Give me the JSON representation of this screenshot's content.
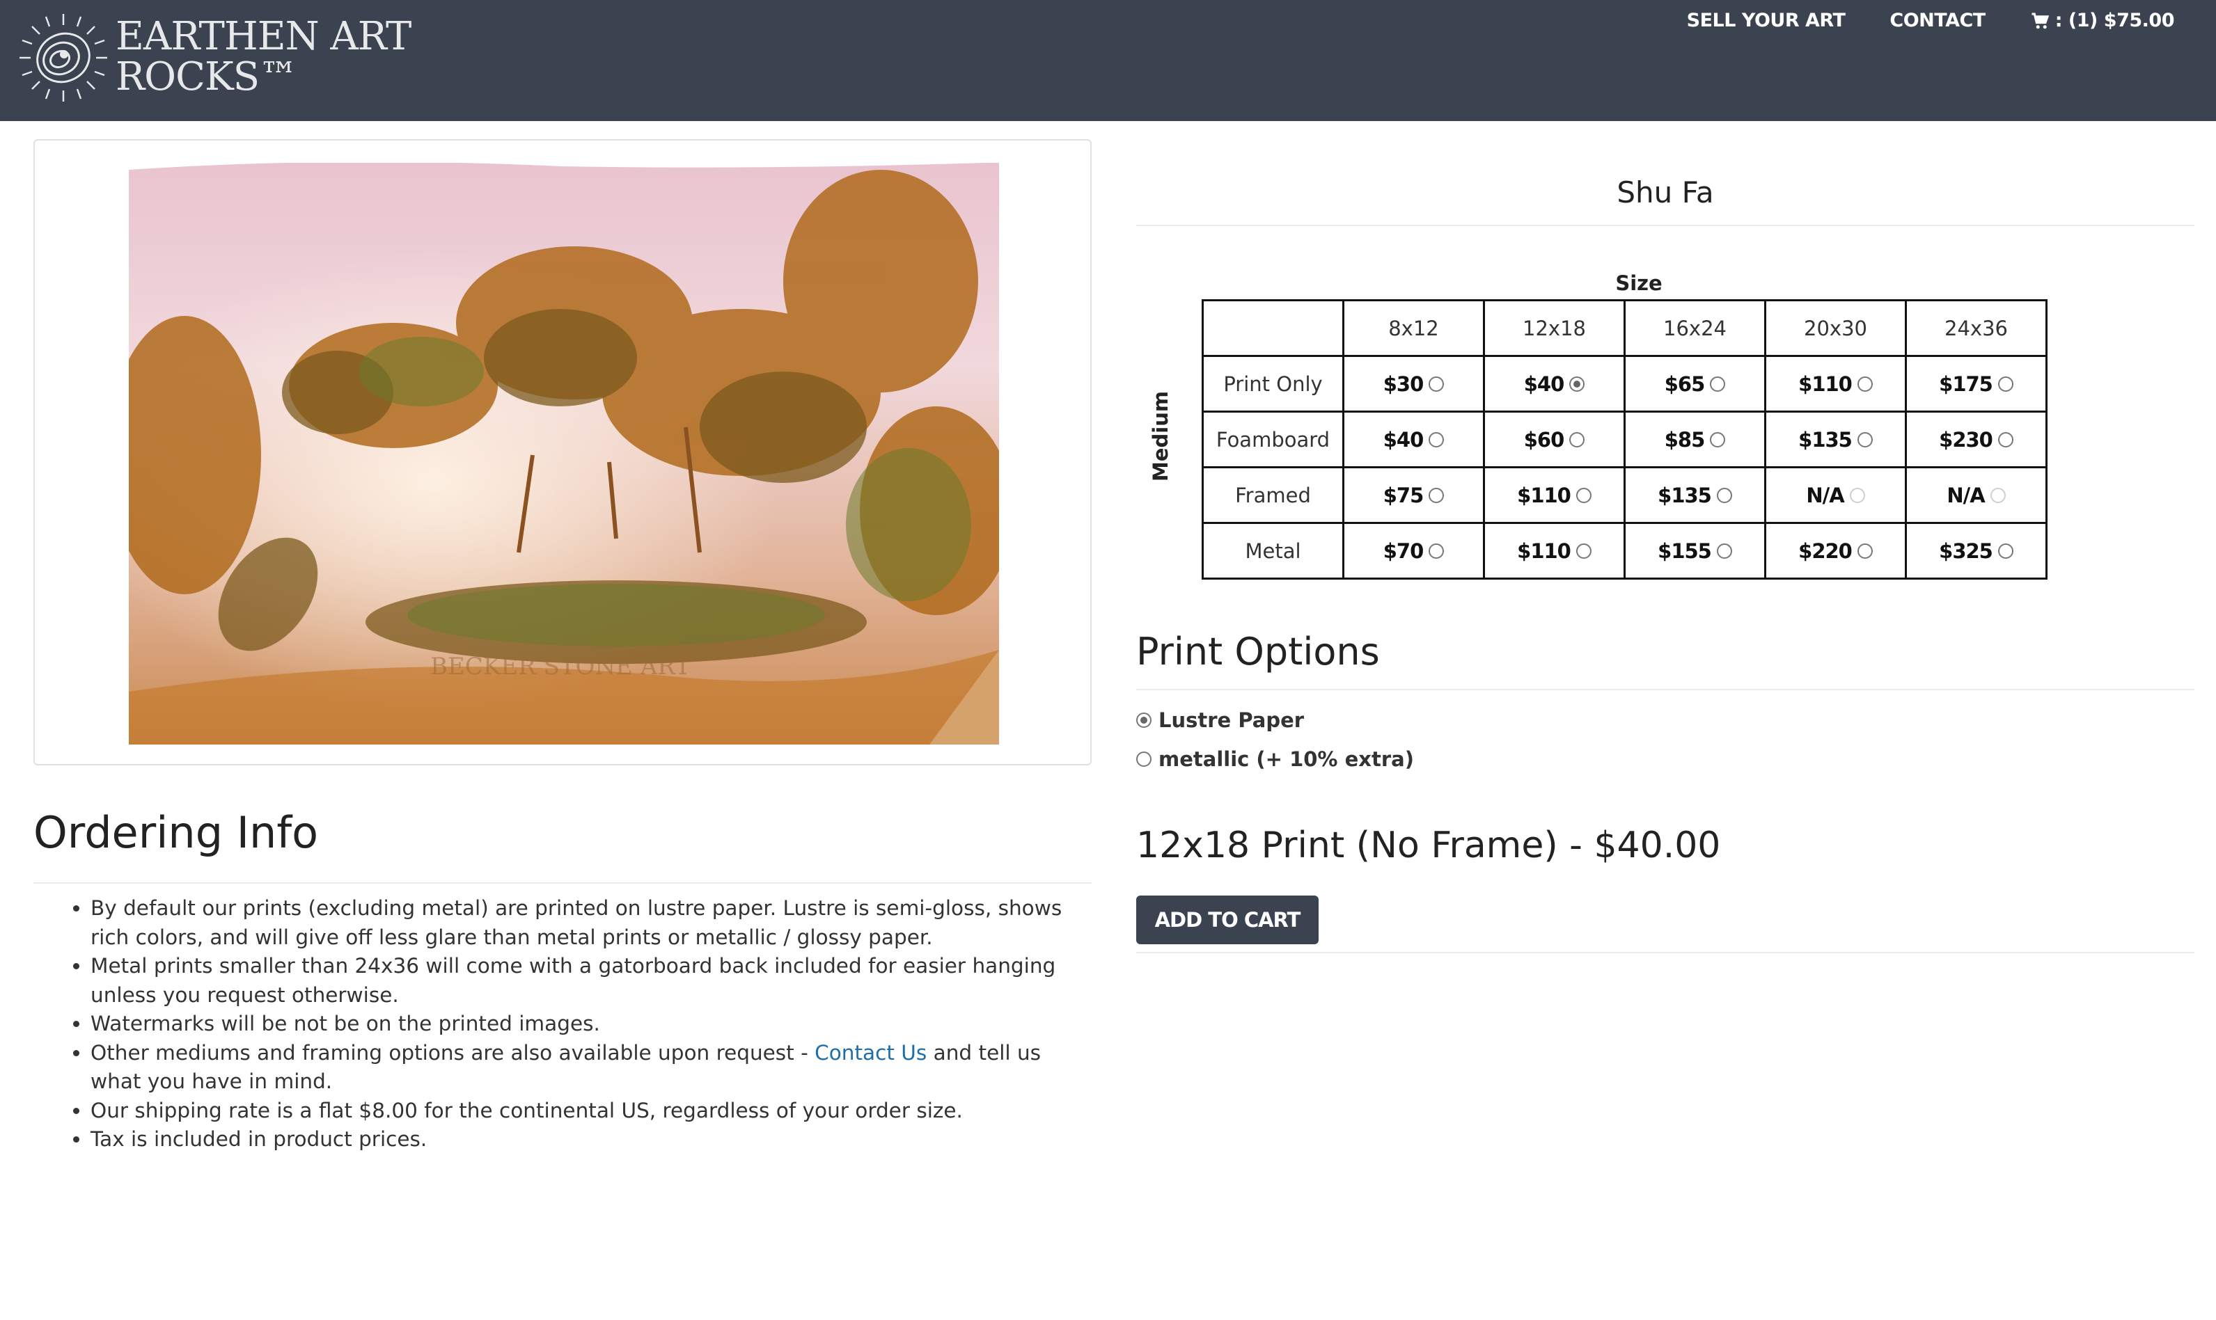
{
  "brand": {
    "line1": "EARTHEN ART",
    "line2": "ROCKS™"
  },
  "nav": {
    "sell": "SELL YOUR ART",
    "contact": "CONTACT",
    "cart": ": (1) $75.00"
  },
  "artwork": {
    "watermark": "BECKER STONE ART"
  },
  "product": {
    "title": "Shu Fa"
  },
  "pricing": {
    "size_label": "Size",
    "medium_label": "Medium",
    "sizes": [
      "8x12",
      "12x18",
      "16x24",
      "20x30",
      "24x36"
    ],
    "rows": [
      {
        "medium": "Print Only",
        "prices": [
          "$30",
          "$40",
          "$65",
          "$110",
          "$175"
        ]
      },
      {
        "medium": "Foamboard",
        "prices": [
          "$40",
          "$60",
          "$85",
          "$135",
          "$230"
        ]
      },
      {
        "medium": "Framed",
        "prices": [
          "$75",
          "$110",
          "$135",
          "N/A",
          "N/A"
        ]
      },
      {
        "medium": "Metal",
        "prices": [
          "$70",
          "$110",
          "$155",
          "$220",
          "$325"
        ]
      }
    ],
    "selected": "Print Only 12x18"
  },
  "print_options": {
    "title": "Print Options",
    "options": [
      "Lustre Paper",
      "metallic (+ 10% extra)"
    ],
    "selected": "Lustre Paper"
  },
  "summary": "12x18 Print (No Frame) - $40.00",
  "add_to_cart": "ADD TO CART",
  "ordering_info": {
    "title": "Ordering Info",
    "items": [
      "By default our prints (excluding metal) are printed on lustre paper. Lustre is semi-gloss, shows rich colors, and will give off less glare than metal prints or metallic / glossy paper.",
      "Metal prints smaller than 24x36 will come with a gatorboard back included for easier hanging unless you request otherwise.",
      "Watermarks will be not be on the printed images.",
      "Other mediums and framing options are also available upon request - ",
      "Our shipping rate is a flat $8.00 for the continental US, regardless of your order size.",
      "Tax is included in product prices."
    ],
    "contact_link": "Contact Us",
    "item4_tail": " and tell us what you have in mind."
  },
  "colors": {
    "navbar": "#3b4250",
    "link": "#1e6fa8",
    "button": "#3b4250"
  }
}
